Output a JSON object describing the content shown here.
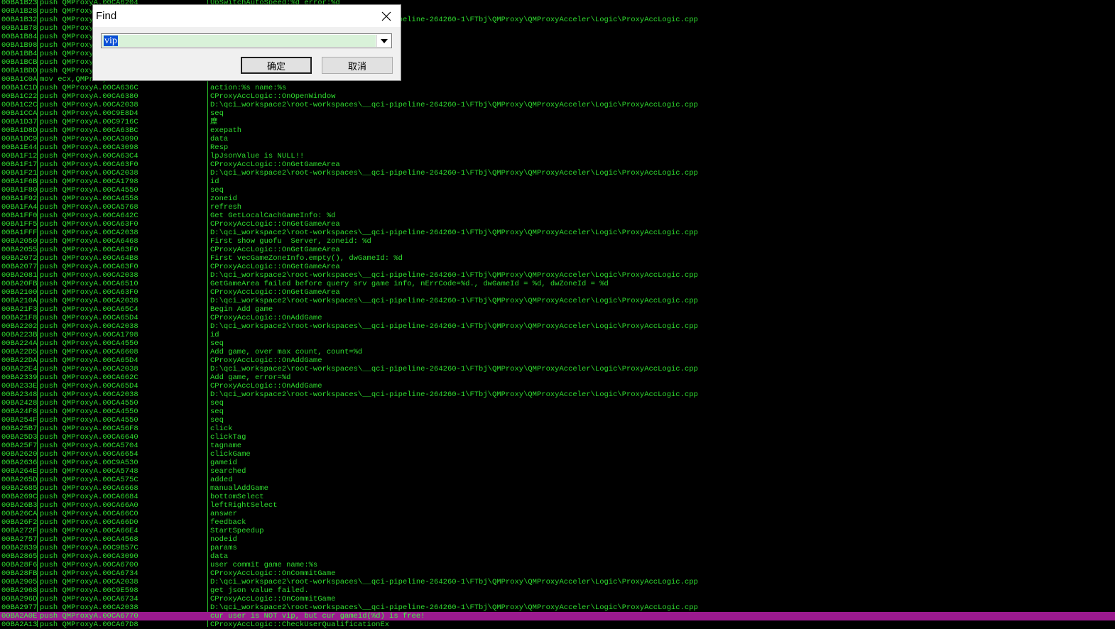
{
  "listing": {
    "rows": [
      {
        "addr": "00BA1B23",
        "instr": "push QMProxyA.00CA6204",
        "comment": "UpSwitchAutoSpeed:%d error:%d"
      },
      {
        "addr": "00BA1B28",
        "instr": "push QMProxyA.00CA2038",
        "comment": ""
      },
      {
        "addr": "00BA1B32",
        "instr": "push QMProxyA.00CA2038",
        "comment": "D:\\qci_workspace2\\root-workspaces\\__qci-pipeline-264260-1\\FTbj\\QMProxy\\QMProxyAcceler\\Logic\\ProxyAccLogic.cpp"
      },
      {
        "addr": "00BA1B78",
        "instr": "push QMProxyA.00CA4550",
        "comment": ""
      },
      {
        "addr": "00BA1B84",
        "instr": "push QMProxyA.00CA6318",
        "comment": ""
      },
      {
        "addr": "00BA1B98",
        "instr": "push QMProxyA.00CA6320",
        "comment": ""
      },
      {
        "addr": "00BA1BB4",
        "instr": "push QMProxyA.00CA632C",
        "comment": ""
      },
      {
        "addr": "00BA1BCB",
        "instr": "push QMProxyA.00CA6344",
        "comment": ""
      },
      {
        "addr": "00BA1BDD",
        "instr": "push QMProxyA.00CA6350",
        "comment": ""
      },
      {
        "addr": "00BA1C0A",
        "instr": "mov ecx,QMProxyA.00CA6360",
        "comment": "not"
      },
      {
        "addr": "00BA1C1D",
        "instr": "push QMProxyA.00CA636C",
        "comment": "action:%s name:%s"
      },
      {
        "addr": "00BA1C22",
        "instr": "push QMProxyA.00CA6380",
        "comment": "CProxyAccLogic::OnOpenWindow"
      },
      {
        "addr": "00BA1C2C",
        "instr": "push QMProxyA.00CA2038",
        "comment": "D:\\qci_workspace2\\root-workspaces\\__qci-pipeline-264260-1\\FTbj\\QMProxy\\QMProxyAcceler\\Logic\\ProxyAccLogic.cpp"
      },
      {
        "addr": "00BA1CCA",
        "instr": "push QMProxyA.00C9E8D4",
        "comment": "seq"
      },
      {
        "addr": "00BA1D37",
        "instr": "push QMProxyA.00C9716C",
        "comment": "塺"
      },
      {
        "addr": "00BA1D8D",
        "instr": "push QMProxyA.00CA63BC",
        "comment": "exepath"
      },
      {
        "addr": "00BA1DC9",
        "instr": "push QMProxyA.00CA3090",
        "comment": "data"
      },
      {
        "addr": "00BA1E44",
        "instr": "push QMProxyA.00CA3098",
        "comment": "Resp"
      },
      {
        "addr": "00BA1F12",
        "instr": "push QMProxyA.00CA63C4",
        "comment": "lpJsonValue is NULL!!"
      },
      {
        "addr": "00BA1F17",
        "instr": "push QMProxyA.00CA63F0",
        "comment": "CProxyAccLogic::OnGetGameArea"
      },
      {
        "addr": "00BA1F21",
        "instr": "push QMProxyA.00CA2038",
        "comment": "D:\\qci_workspace2\\root-workspaces\\__qci-pipeline-264260-1\\FTbj\\QMProxy\\QMProxyAcceler\\Logic\\ProxyAccLogic.cpp"
      },
      {
        "addr": "00BA1F6B",
        "instr": "push QMProxyA.00CA1798",
        "comment": "id"
      },
      {
        "addr": "00BA1F80",
        "instr": "push QMProxyA.00CA4550",
        "comment": "seq"
      },
      {
        "addr": "00BA1F92",
        "instr": "push QMProxyA.00CA4558",
        "comment": "zoneid"
      },
      {
        "addr": "00BA1FA4",
        "instr": "push QMProxyA.00CA5768",
        "comment": "refresh"
      },
      {
        "addr": "00BA1FF0",
        "instr": "push QMProxyA.00CA642C",
        "comment": "Get GetLocalCachGameInfo: %d"
      },
      {
        "addr": "00BA1FF5",
        "instr": "push QMProxyA.00CA63F0",
        "comment": "CProxyAccLogic::OnGetGameArea"
      },
      {
        "addr": "00BA1FFF",
        "instr": "push QMProxyA.00CA2038",
        "comment": "D:\\qci_workspace2\\root-workspaces\\__qci-pipeline-264260-1\\FTbj\\QMProxy\\QMProxyAcceler\\Logic\\ProxyAccLogic.cpp"
      },
      {
        "addr": "00BA2050",
        "instr": "push QMProxyA.00CA6468",
        "comment": "First show guofu  Server, zoneid: %d"
      },
      {
        "addr": "00BA2055",
        "instr": "push QMProxyA.00CA63F0",
        "comment": "CProxyAccLogic::OnGetGameArea"
      },
      {
        "addr": "00BA2072",
        "instr": "push QMProxyA.00CA64B8",
        "comment": "First vecGameZoneInfo.empty(), dwGameId: %d"
      },
      {
        "addr": "00BA2077",
        "instr": "push QMProxyA.00CA63F0",
        "comment": "CProxyAccLogic::OnGetGameArea"
      },
      {
        "addr": "00BA2081",
        "instr": "push QMProxyA.00CA2038",
        "comment": "D:\\qci_workspace2\\root-workspaces\\__qci-pipeline-264260-1\\FTbj\\QMProxy\\QMProxyAcceler\\Logic\\ProxyAccLogic.cpp"
      },
      {
        "addr": "00BA20FB",
        "instr": "push QMProxyA.00CA6510",
        "comment": "GetGameArea failed before query srv game info, nErrCode=%d., dwGameId = %d, dwZoneId = %d"
      },
      {
        "addr": "00BA2100",
        "instr": "push QMProxyA.00CA63F0",
        "comment": "CProxyAccLogic::OnGetGameArea"
      },
      {
        "addr": "00BA210A",
        "instr": "push QMProxyA.00CA2038",
        "comment": "D:\\qci_workspace2\\root-workspaces\\__qci-pipeline-264260-1\\FTbj\\QMProxy\\QMProxyAcceler\\Logic\\ProxyAccLogic.cpp"
      },
      {
        "addr": "00BA21F3",
        "instr": "push QMProxyA.00CA65C4",
        "comment": "Begin Add game"
      },
      {
        "addr": "00BA21F8",
        "instr": "push QMProxyA.00CA65D4",
        "comment": "CProxyAccLogic::OnAddGame"
      },
      {
        "addr": "00BA2202",
        "instr": "push QMProxyA.00CA2038",
        "comment": "D:\\qci_workspace2\\root-workspaces\\__qci-pipeline-264260-1\\FTbj\\QMProxy\\QMProxyAcceler\\Logic\\ProxyAccLogic.cpp"
      },
      {
        "addr": "00BA223B",
        "instr": "push QMProxyA.00CA1798",
        "comment": "id"
      },
      {
        "addr": "00BA224A",
        "instr": "push QMProxyA.00CA4550",
        "comment": "seq"
      },
      {
        "addr": "00BA22D5",
        "instr": "push QMProxyA.00CA6608",
        "comment": "Add game, over max count, count=%d"
      },
      {
        "addr": "00BA22DA",
        "instr": "push QMProxyA.00CA65D4",
        "comment": "CProxyAccLogic::OnAddGame"
      },
      {
        "addr": "00BA22E4",
        "instr": "push QMProxyA.00CA2038",
        "comment": "D:\\qci_workspace2\\root-workspaces\\__qci-pipeline-264260-1\\FTbj\\QMProxy\\QMProxyAcceler\\Logic\\ProxyAccLogic.cpp"
      },
      {
        "addr": "00BA2339",
        "instr": "push QMProxyA.00CA662C",
        "comment": "Add game, error=%d"
      },
      {
        "addr": "00BA233E",
        "instr": "push QMProxyA.00CA65D4",
        "comment": "CProxyAccLogic::OnAddGame"
      },
      {
        "addr": "00BA2348",
        "instr": "push QMProxyA.00CA2038",
        "comment": "D:\\qci_workspace2\\root-workspaces\\__qci-pipeline-264260-1\\FTbj\\QMProxy\\QMProxyAcceler\\Logic\\ProxyAccLogic.cpp"
      },
      {
        "addr": "00BA2428",
        "instr": "push QMProxyA.00CA4550",
        "comment": "seq"
      },
      {
        "addr": "00BA24F8",
        "instr": "push QMProxyA.00CA4550",
        "comment": "seq"
      },
      {
        "addr": "00BA254F",
        "instr": "push QMProxyA.00CA4550",
        "comment": "seq"
      },
      {
        "addr": "00BA25B7",
        "instr": "push QMProxyA.00CA56F8",
        "comment": "click"
      },
      {
        "addr": "00BA25D3",
        "instr": "push QMProxyA.00CA6640",
        "comment": "clickTag"
      },
      {
        "addr": "00BA25F7",
        "instr": "push QMProxyA.00CA5704",
        "comment": "tagname"
      },
      {
        "addr": "00BA2620",
        "instr": "push QMProxyA.00CA6654",
        "comment": "clickGame"
      },
      {
        "addr": "00BA2636",
        "instr": "push QMProxyA.00C9A530",
        "comment": "gameid"
      },
      {
        "addr": "00BA264E",
        "instr": "push QMProxyA.00CA5748",
        "comment": "searched"
      },
      {
        "addr": "00BA265D",
        "instr": "push QMProxyA.00CA575C",
        "comment": "added"
      },
      {
        "addr": "00BA2685",
        "instr": "push QMProxyA.00CA6668",
        "comment": "manualAddGame"
      },
      {
        "addr": "00BA269C",
        "instr": "push QMProxyA.00CA6684",
        "comment": "bottomSelect"
      },
      {
        "addr": "00BA26B3",
        "instr": "push QMProxyA.00CA66A0",
        "comment": "leftRightSelect"
      },
      {
        "addr": "00BA26CA",
        "instr": "push QMProxyA.00CA66C0",
        "comment": "answer"
      },
      {
        "addr": "00BA26F2",
        "instr": "push QMProxyA.00CA66D0",
        "comment": "feedback"
      },
      {
        "addr": "00BA272F",
        "instr": "push QMProxyA.00CA66E4",
        "comment": "StartSpeedup"
      },
      {
        "addr": "00BA2757",
        "instr": "push QMProxyA.00CA4568",
        "comment": "nodeid"
      },
      {
        "addr": "00BA2839",
        "instr": "push QMProxyA.00C9B57C",
        "comment": "params"
      },
      {
        "addr": "00BA2865",
        "instr": "push QMProxyA.00CA3090",
        "comment": "data"
      },
      {
        "addr": "00BA28F6",
        "instr": "push QMProxyA.00CA6700",
        "comment": "user commit game name:%s"
      },
      {
        "addr": "00BA28FB",
        "instr": "push QMProxyA.00CA6734",
        "comment": "CProxyAccLogic::OnCommitGame"
      },
      {
        "addr": "00BA2905",
        "instr": "push QMProxyA.00CA2038",
        "comment": "D:\\qci_workspace2\\root-workspaces\\__qci-pipeline-264260-1\\FTbj\\QMProxy\\QMProxyAcceler\\Logic\\ProxyAccLogic.cpp"
      },
      {
        "addr": "00BA2968",
        "instr": "push QMProxyA.00C9E598",
        "comment": "get json value failed."
      },
      {
        "addr": "00BA296D",
        "instr": "push QMProxyA.00CA6734",
        "comment": "CProxyAccLogic::OnCommitGame"
      },
      {
        "addr": "00BA2977",
        "instr": "push QMProxyA.00CA2038",
        "comment": "D:\\qci_workspace2\\root-workspaces\\__qci-pipeline-264260-1\\FTbj\\QMProxy\\QMProxyAcceler\\Logic\\ProxyAccLogic.cpp"
      },
      {
        "addr": "00BA2A0E",
        "instr": "push QMProxyA.00CA6770",
        "comment": "cur user is NOT vip, but cur gameid(%d) is free!",
        "highlighted": true
      },
      {
        "addr": "00BA2A13",
        "instr": "push QMProxyA.00CA67D8",
        "comment": "CProxyAccLogic::CheckUserQualificationEx"
      }
    ]
  },
  "find_dialog": {
    "title": "Find",
    "close_icon": "close-icon",
    "search_value": "vip",
    "ok_label": "确定",
    "cancel_label": "取消"
  },
  "colors": {
    "background": "#000000",
    "text": "#2fdc2f",
    "highlight_row": "#9b1a8f",
    "selection": "#0a4fd6"
  }
}
